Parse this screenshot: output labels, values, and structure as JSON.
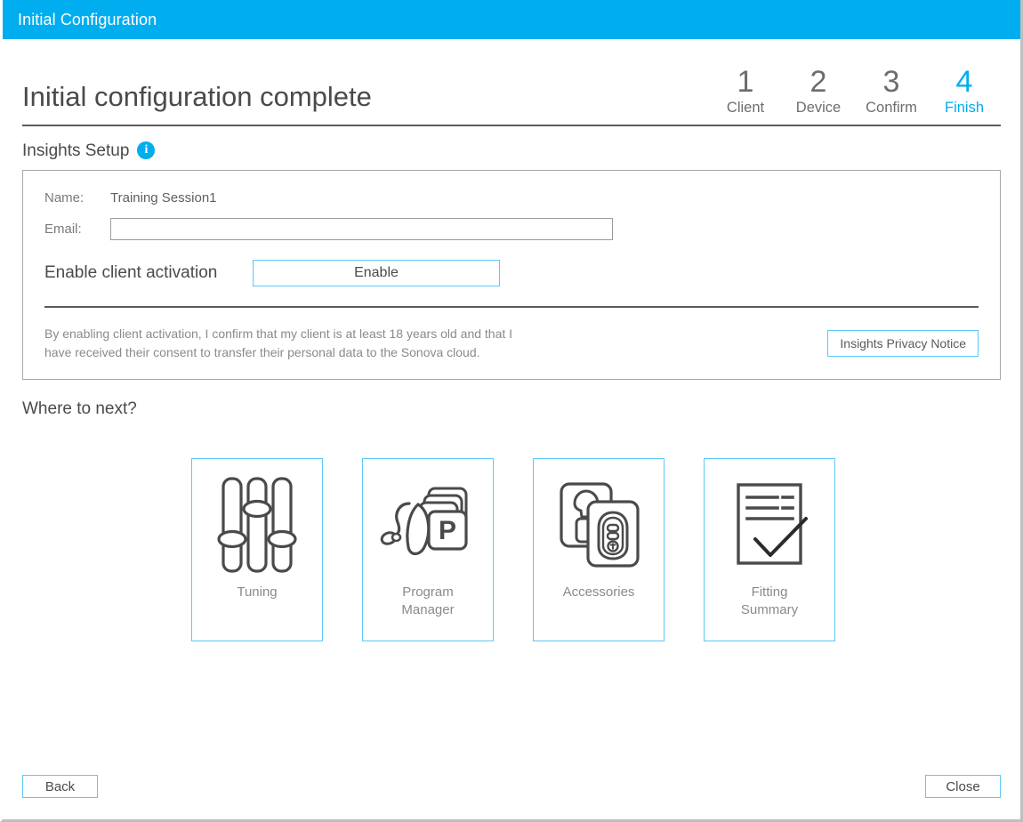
{
  "window": {
    "title": "Initial Configuration",
    "accent_color": "#00ADEF",
    "border_color": "#5bc8f5"
  },
  "header": {
    "page_title": "Initial configuration complete",
    "steps": [
      {
        "number": "1",
        "label": "Client",
        "active": false
      },
      {
        "number": "2",
        "label": "Device",
        "active": false
      },
      {
        "number": "3",
        "label": "Confirm",
        "active": false
      },
      {
        "number": "4",
        "label": "Finish",
        "active": true
      }
    ]
  },
  "insights": {
    "section_title": "Insights Setup",
    "info_icon": "info-icon",
    "info_icon_glyph": "i",
    "name_label": "Name:",
    "name_value": "Training Session1",
    "email_label": "Email:",
    "email_value": "",
    "email_placeholder": "",
    "activation_label": "Enable client activation",
    "enable_button": "Enable",
    "consent_text": "By enabling client activation, I confirm that my client is at least 18 years old and that I have received their consent to transfer their personal data to the Sonova cloud.",
    "privacy_button": "Insights Privacy Notice"
  },
  "where_next": {
    "heading": "Where to next?",
    "cards": [
      {
        "label": "Tuning",
        "icon": "sliders-icon"
      },
      {
        "label": "Program\nManager",
        "label_line1": "Program",
        "label_line2": "Manager",
        "icon": "hearing-aid-programs-icon"
      },
      {
        "label": "Accessories",
        "icon": "accessories-icon"
      },
      {
        "label": "Fitting\nSummary",
        "label_line1": "Fitting",
        "label_line2": "Summary",
        "icon": "document-check-icon"
      }
    ]
  },
  "footer": {
    "back_button": "Back",
    "close_button": "Close"
  }
}
